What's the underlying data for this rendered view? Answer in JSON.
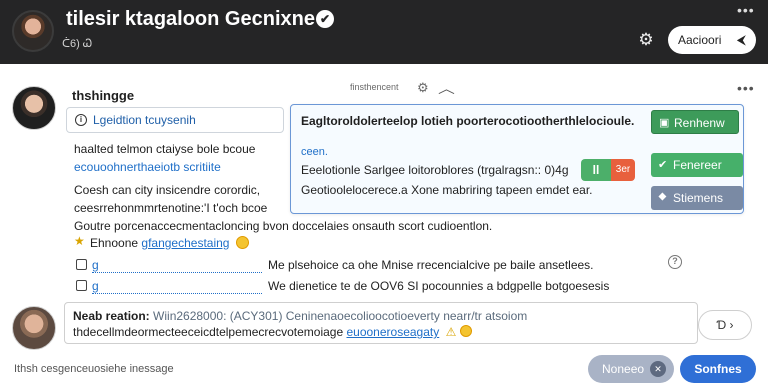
{
  "header": {
    "title": "tilesir ktagaloon Gecnixne",
    "subtitle": "ᑖ6) Ꮗ",
    "action_label": "Aacioori",
    "action_arrow": "⮜",
    "menu_glyph": "•••",
    "gear_glyph": "⚙",
    "verified_glyph": "✔"
  },
  "message": {
    "sender": "thshingge",
    "meta": "finsthencent",
    "chip_text": "Lgeidtion tcuysenih",
    "lines": [
      "haalted telmon ctaiyse bole bcoue",
      "ecouoohnerthaeiotb scritiite",
      "Coesh can city insicendre corordic,",
      "ceesrrehonmmrtenotine:'I t'och bcoe",
      "Goutre porcenaccecmentacloncing bvon doccelaies onsauth scort cudioentlon."
    ],
    "line6_text": "Ehnoone",
    "line6_link": "gfangechestaing",
    "rules": [
      {
        "link": "g",
        "text": "Me plsehoice ca ohe Mnise rrecencialcive pe baile ansetlees."
      },
      {
        "link": "g",
        "text": "We dienetice te de OOV6 SI pocounnies a bdgpelle botgoesesis"
      }
    ],
    "icons": {
      "gear": "⚙",
      "chevron": "︿",
      "star": "★",
      "help": "?",
      "box": "□"
    }
  },
  "card": {
    "title": "Eagltoroldolerteelop lotieh poorterocotiootherthlelocioule.",
    "label": "ceen.",
    "line1": "Eeelotionle Sarlgee loitoroblores (trgalragsn:: 0)4g",
    "line2": "Geotioolelocerece.a Xone mabriring tapeen emdet ear.",
    "pill_left": "ll",
    "pill_right": "3er",
    "buttons": [
      {
        "icon": "▣",
        "label": "Renhenw"
      },
      {
        "icon": "✔",
        "label": "Fenereer"
      },
      {
        "icon": "⯁",
        "label": "Stiemens"
      }
    ]
  },
  "reply": {
    "label": "Neab reation:",
    "meta": "Wiin2628000: (ACY301) Ceninenaoecolioocotioeverty nearr/tr atsoiom",
    "body": "thdecellmdeormecteeceicdtelpemecrecvotemoiage",
    "link": "euooneroseagaty",
    "attach_label": "Ɗ ›"
  },
  "footer": {
    "hint": "Ithsh cesgenceuosiehe inessage",
    "secondary_label": "Noneeo",
    "secondary_icon": "✕",
    "primary_label": "Sonfnes"
  }
}
